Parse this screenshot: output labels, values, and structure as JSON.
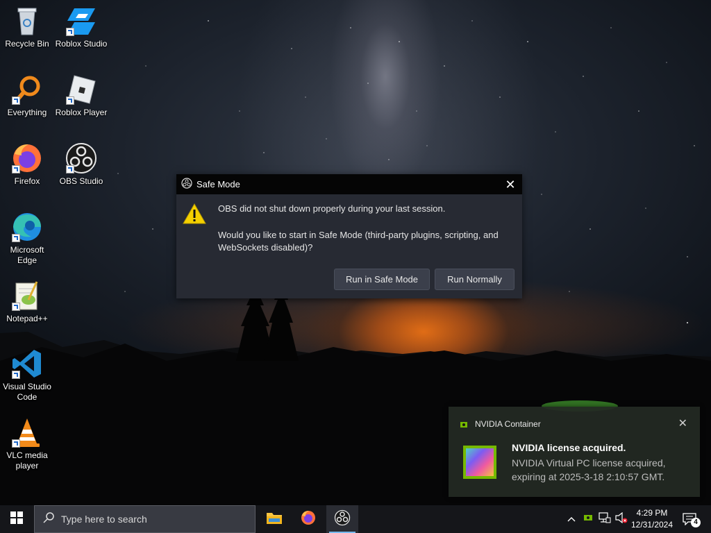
{
  "desktop": {
    "icons": [
      {
        "label": "Recycle Bin",
        "icon": "recycle-bin-icon"
      },
      {
        "label": "Roblox Studio",
        "icon": "roblox-studio-icon"
      },
      {
        "label": "Everything",
        "icon": "everything-search-icon"
      },
      {
        "label": "Roblox Player",
        "icon": "roblox-player-icon"
      },
      {
        "label": "Firefox",
        "icon": "firefox-icon"
      },
      {
        "label": "OBS Studio",
        "icon": "obs-studio-icon"
      },
      {
        "label": "Microsoft Edge",
        "icon": "edge-icon"
      },
      {
        "label": "Notepad++",
        "icon": "notepadpp-icon"
      },
      {
        "label": "Visual Studio Code",
        "icon": "vscode-icon"
      },
      {
        "label": "VLC media player",
        "icon": "vlc-icon"
      }
    ]
  },
  "dialog": {
    "title": "Safe Mode",
    "message1": "OBS did not shut down properly during your last session.",
    "message2": "Would you like to start in Safe Mode (third-party plugins, scripting, and WebSockets disabled)?",
    "btn_safe": "Run in Safe Mode",
    "btn_normal": "Run Normally",
    "close_glyph": "✕"
  },
  "notification": {
    "app": "NVIDIA Container",
    "title": "NVIDIA license acquired.",
    "body": "NVIDIA Virtual PC license acquired, expiring at 2025-3-18 2:10:57 GMT.",
    "close_glyph": "✕"
  },
  "taskbar": {
    "search_placeholder": "Type here to search",
    "time": "4:29 PM",
    "date": "12/31/2024",
    "notification_count": "4",
    "accent": "#76b9ed"
  }
}
